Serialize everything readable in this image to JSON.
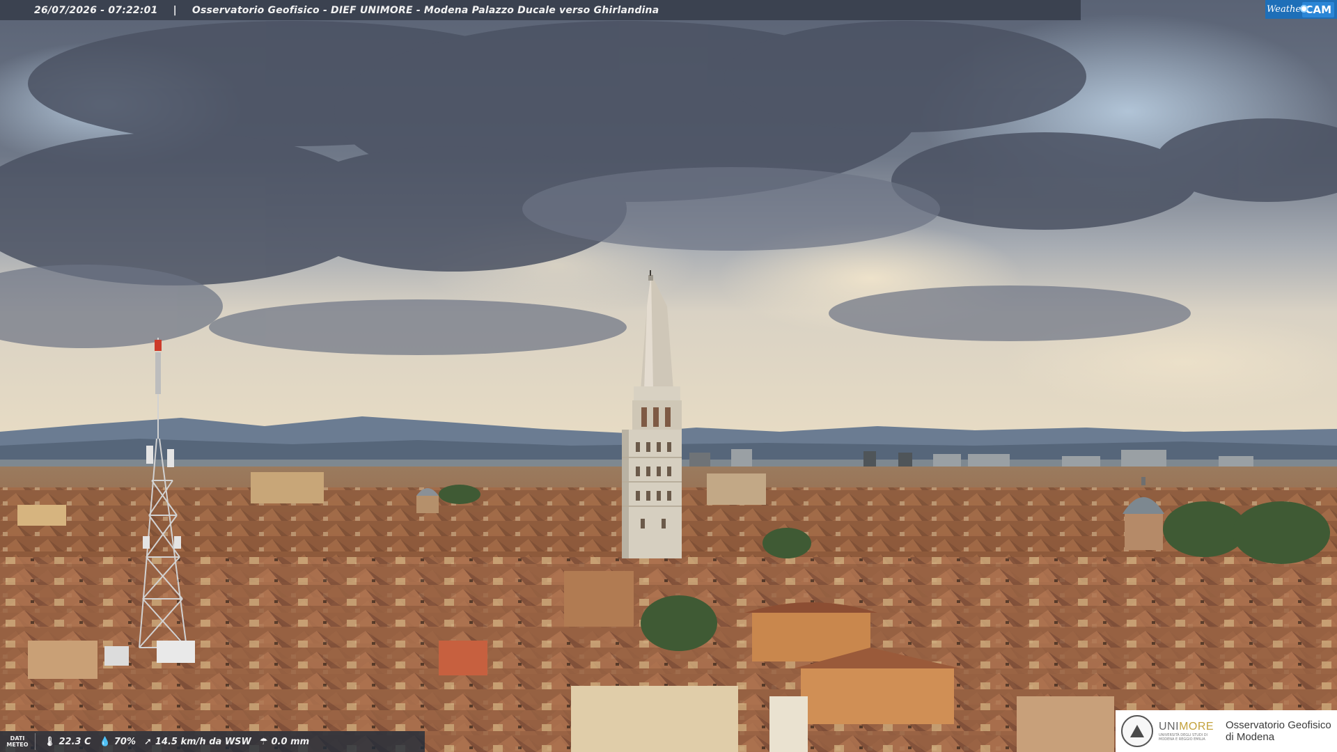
{
  "camera": {
    "timestamp": "26/07/2026 - 07:22:01",
    "separator": "|",
    "title": "Osservatorio Geofisico - DIEF UNIMORE - Modena Palazzo Ducale verso Ghirlandina"
  },
  "branding": {
    "weathercam_prefix": "Weather",
    "weathercam_suffix": "CAM",
    "unimore_part1": "UNI",
    "unimore_part2": "MORE",
    "unimore_sub": "UNIVERSITÀ DEGLI STUDI DI MODENA E REGGIO EMILIA",
    "observatory_line1": "Osservatorio Geofisico",
    "observatory_line2": "di Modena"
  },
  "meteo": {
    "label_line1": "DATI",
    "label_line2": "METEO",
    "temperature": "22.3 C",
    "humidity": "70%",
    "wind": "14.5 km/h da WSW",
    "rain": "0.0 mm",
    "icons": [
      "thermometer-icon",
      "droplet-icon",
      "wind-icon",
      "rain-icon"
    ]
  },
  "colors": {
    "topbar_bg": "#373e4b",
    "weathercam_blue": "#1e6fb8",
    "unimore_gold": "#c3a13b"
  }
}
